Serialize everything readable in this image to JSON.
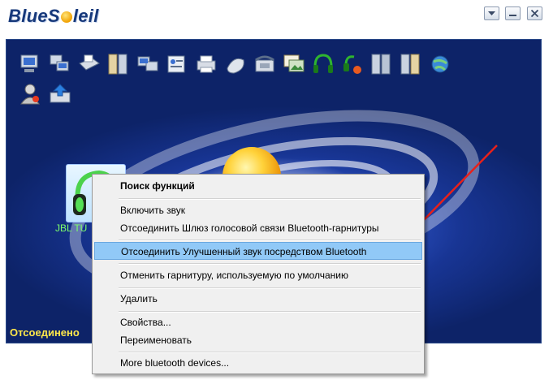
{
  "app": {
    "logo_text_a": "BlueS",
    "logo_text_b": "leil"
  },
  "window_controls": [
    "minimize-to-tray",
    "minimize",
    "close"
  ],
  "toolbar_icons": [
    "network-access-icon",
    "lan-access-icon",
    "fax-icon",
    "file-transfer-icon",
    "pan-network-icon",
    "business-card-icon",
    "printer-icon",
    "mouse-icon",
    "phone-fax-icon",
    "image-transfer-icon",
    "headset-icon",
    "headphone-remote-icon",
    "sync-icon",
    "pim-sync-icon",
    "globe-network-icon",
    "user-profile-icon",
    "upload-tray-icon"
  ],
  "device": {
    "label": "JBL TU"
  },
  "status": "Отсоединено",
  "context_menu": {
    "items": [
      {
        "label": "Поиск функций",
        "bold": true
      },
      {
        "label": "Включить звук"
      },
      {
        "label": "Отсоединить Шлюз голосовой связи Bluetooth-гарнитуры"
      },
      {
        "label": "Отсоединить Улучшенный звук посредством Bluetooth",
        "highlighted": true
      },
      {
        "label": "Отменить гарнитуру, используемую по умолчанию"
      },
      {
        "label": "Удалить"
      },
      {
        "label": "Свойства..."
      },
      {
        "label": "Переименовать"
      },
      {
        "label": "More bluetooth devices..."
      }
    ]
  },
  "colors": {
    "highlight": "#91c9f7",
    "status_text": "#ffe84a",
    "device_label": "#7dff6a",
    "arrow": "#e8201a",
    "canvas_dark": "#0d2368"
  }
}
